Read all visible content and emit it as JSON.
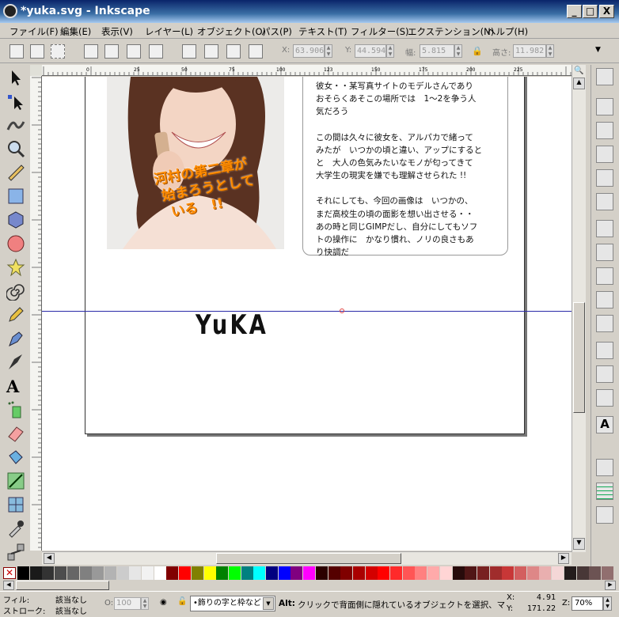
{
  "window": {
    "title": "*yuka.svg - Inkscape",
    "buttons": [
      "_",
      "□",
      "X"
    ]
  },
  "menu": [
    "ファイル(F)",
    "編集(E)",
    "表示(V)",
    "レイヤー(L)",
    "オブジェクト(O)",
    "パス(P)",
    "テキスト(T)",
    "フィルター(S)",
    "エクステンション(N)",
    "ヘルプ(H)"
  ],
  "controls": {
    "x_label": "X:",
    "x_value": "63.906",
    "y_label": "Y:",
    "y_value": "44.594",
    "w_label": "幅:",
    "w_value": "5.815",
    "h_label": "高さ:",
    "h_value": "11.982"
  },
  "ruler": {
    "h_ticks": [
      "0",
      "",
      "25",
      "",
      "50",
      "",
      "75",
      "",
      "100",
      "",
      "123",
      "",
      "150",
      "",
      "175",
      "",
      "200",
      "",
      "225"
    ]
  },
  "canvas": {
    "photo_caption": [
      "河村の第二章が",
      "始まろうとして",
      "いる　!!"
    ],
    "textbox": {
      "p1": [
        "彼女・・某写真サイトのモデルさんであり",
        "おそらくあそこの場所では　1～2を争う人",
        "気だろう"
      ],
      "p2": [
        "この間は久々に彼女を、アルパカで緒って",
        "みたが　いつかの頃と違い、アップにすると",
        "と　大人の色気みたいなモノが匂ってきて",
        "大学生の現実を嫌でも理解させられた !!"
      ],
      "p3": [
        "それにしても、今回の画像は　いつかの、",
        "まだ高校生の頃の面影を想い出させる・・",
        "あの時と同じGIMPだし、自分にしてもソフ",
        "トの操作に　かなり慣れ、ノリの良さもあ",
        "り快調だ"
      ]
    },
    "logo": "YuKA"
  },
  "palette_colors": [
    "#000000",
    "#1a1a1a",
    "#333333",
    "#4d4d4d",
    "#666666",
    "#808080",
    "#999999",
    "#b3b3b3",
    "#cccccc",
    "#e6e6e6",
    "#f2f2f2",
    "#ffffff",
    "#800000",
    "#ff0000",
    "#808000",
    "#ffff00",
    "#008000",
    "#00ff00",
    "#008080",
    "#00ffff",
    "#000080",
    "#0000ff",
    "#800080",
    "#ff00ff",
    "#2b0000",
    "#550000",
    "#800000",
    "#aa0000",
    "#d40000",
    "#ff0000",
    "#ff2a2a",
    "#ff5555",
    "#ff8080",
    "#ffaaaa",
    "#ffd5d5",
    "#280b0b",
    "#501616",
    "#782121",
    "#a02c2c",
    "#c83737",
    "#d35f5f",
    "#de8787",
    "#e9afaf",
    "#f4d7d7",
    "#241c1c",
    "#483737",
    "#6c5353",
    "#916f6f"
  ],
  "status": {
    "fill_label": "フィル:",
    "fill_value": "該当なし",
    "stroke_label": "ストローク:",
    "stroke_value": "該当なし",
    "opacity_label": "O:",
    "opacity_value": "100",
    "layer": "•飾りの字と枠など",
    "message_key": "Alt:",
    "message": "クリックで背面側に隠れているオブジェクトを選択、マウス...",
    "coord_x_label": "X:",
    "coord_x": "4.91",
    "coord_y_label": "Y:",
    "coord_y": "171.22",
    "zoom_label": "Z:",
    "zoom": "70%"
  },
  "colors": {
    "title_bg": "#0a246a",
    "guide": "#2a2aa8",
    "caption": "#ff8c00"
  }
}
